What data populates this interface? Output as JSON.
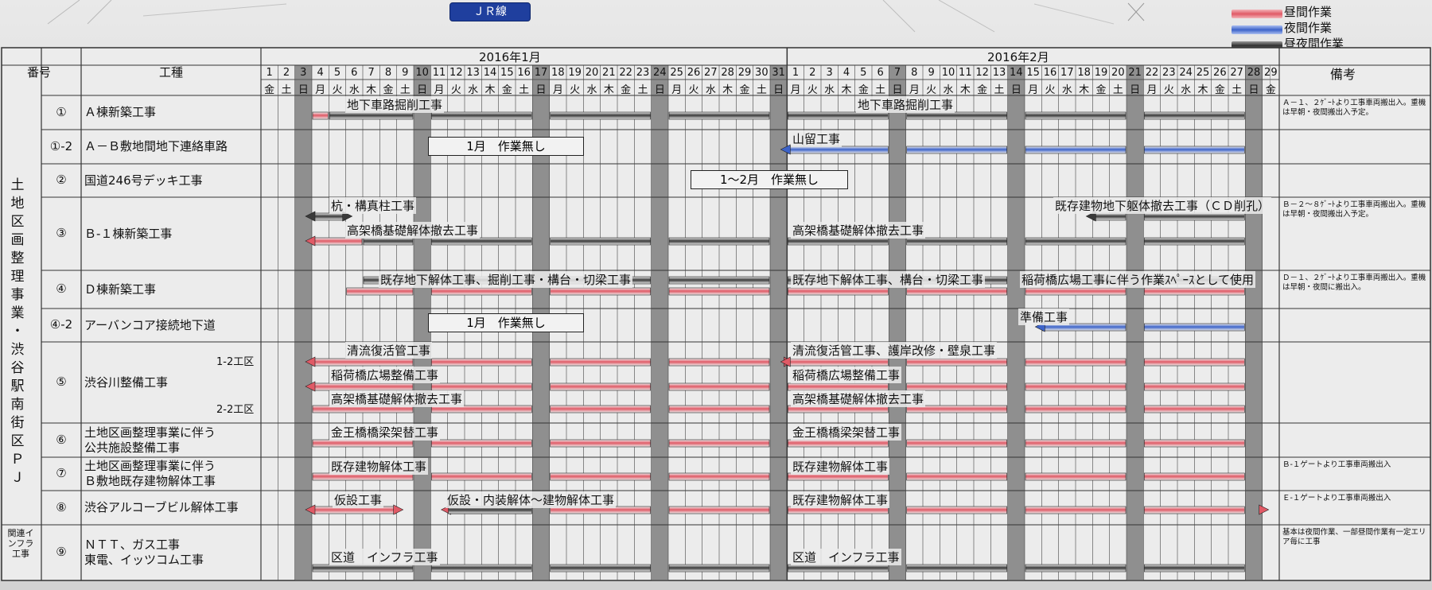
{
  "header": {
    "badge": "ＪＲ線",
    "month1": "2016年1月",
    "month2": "2016年2月",
    "col_no": "番号",
    "col_type": "工種",
    "col_remarks": "備考"
  },
  "legend": [
    {
      "label": "昼間作業",
      "color": "#e05a66"
    },
    {
      "label": "夜間作業",
      "color": "#3d63c9"
    },
    {
      "label": "昼夜間作業",
      "color": "#3a3a3a"
    }
  ],
  "colors": {
    "day": "#e05a66",
    "night": "#3d63c9",
    "both": "#3a3a3a",
    "sunday": "#8f8f8f"
  },
  "jan_days": [
    "1",
    "2",
    "3",
    "4",
    "5",
    "6",
    "7",
    "8",
    "9",
    "10",
    "11",
    "12",
    "13",
    "14",
    "15",
    "16",
    "17",
    "18",
    "19",
    "20",
    "21",
    "22",
    "23",
    "24",
    "25",
    "26",
    "27",
    "28",
    "29",
    "30",
    "31"
  ],
  "jan_weekdays": [
    "金",
    "土",
    "日",
    "月",
    "火",
    "水",
    "木",
    "金",
    "土",
    "日",
    "月",
    "火",
    "水",
    "木",
    "金",
    "土",
    "日",
    "月",
    "火",
    "水",
    "木",
    "金",
    "土",
    "日",
    "月",
    "火",
    "水",
    "木",
    "金",
    "土",
    "日"
  ],
  "feb_days": [
    "1",
    "2",
    "3",
    "4",
    "5",
    "6",
    "7",
    "8",
    "9",
    "10",
    "11",
    "12",
    "13",
    "14",
    "15",
    "16",
    "17",
    "18",
    "19",
    "20",
    "21",
    "22",
    "23",
    "24",
    "25",
    "26",
    "27",
    "28",
    "29"
  ],
  "feb_weekdays": [
    "月",
    "火",
    "水",
    "木",
    "金",
    "土",
    "日",
    "月",
    "火",
    "水",
    "木",
    "金",
    "土",
    "日",
    "月",
    "火",
    "水",
    "木",
    "金",
    "土",
    "日",
    "月",
    "火",
    "水",
    "木",
    "金",
    "土",
    "日",
    "金"
  ],
  "group_labels": {
    "main": [
      "土",
      "地",
      "区",
      "画",
      "整",
      "理",
      "事",
      "業",
      "・",
      "渋",
      "谷",
      "駅",
      "南",
      "街",
      "区",
      "Ｐ",
      "Ｊ"
    ],
    "infra": "関連インフラ工事"
  },
  "rows": [
    {
      "no": "①",
      "type": [
        "Ａ棟新築工事"
      ],
      "remarks": "Ａ－１、２ｹﾞｰﾄより工事車両搬出入。重機は早朝・夜間搬出入予定。"
    },
    {
      "no": "①-2",
      "type": [
        "Ａ－Ｂ敷地間地下連絡車路"
      ],
      "remarks": ""
    },
    {
      "no": "②",
      "type": [
        "国道246号デッキ工事"
      ],
      "remarks": ""
    },
    {
      "no": "③",
      "type": [
        "Ｂ-１棟新築工事"
      ],
      "remarks": "Ｂ－２～８ｹﾞｰﾄより工事車両搬出入。重機は早朝・夜間搬出入予定。"
    },
    {
      "no": "④",
      "type": [
        "Ｄ棟新築工事"
      ],
      "remarks": "Ｄ－１、２ｹﾞｰﾄより工事車両搬出入。重機は早朝・夜間に搬出入。"
    },
    {
      "no": "④-2",
      "type": [
        "アーバンコア接続地下道"
      ],
      "remarks": ""
    },
    {
      "no": "⑤",
      "type": [
        "渋谷川整備工事"
      ],
      "remarks": "",
      "sub1": "1-2工区",
      "sub2": "2-2工区"
    },
    {
      "no": "⑥",
      "type": [
        "土地区画整理事業に伴う",
        "公共施設整備工事"
      ],
      "remarks": ""
    },
    {
      "no": "⑦",
      "type": [
        "土地区画整理事業に伴う",
        "Ｂ敷地既存建物解体工事"
      ],
      "remarks": "Ｂ-１ゲートより工事車両搬出入"
    },
    {
      "no": "⑧",
      "type": [
        "渋谷アルコーブビル解体工事"
      ],
      "remarks": "Ｅ-１ゲートより工事車両搬出入"
    },
    {
      "no": "⑨",
      "type": [
        "ＮＴＴ、ガス工事",
        "東電、イッツコム工事"
      ],
      "remarks": "基本は夜間作業、一部昼間作業有一定エリア毎に工事"
    }
  ],
  "no_work": {
    "r1": "1月　作業無し",
    "r2": "1～2月　作業無し",
    "r5": "1月　作業無し"
  },
  "tasks": [
    {
      "id": "t0a",
      "text": "地下車路掘削工事"
    },
    {
      "id": "t0b",
      "text": "地下車路掘削工事"
    },
    {
      "id": "t1a",
      "text": "山留工事"
    },
    {
      "id": "t3a",
      "text": "杭・構真柱工事"
    },
    {
      "id": "t3b",
      "text": "高架橋基礎解体撤去工事"
    },
    {
      "id": "t3c",
      "text": "高架橋基礎解体撤去工事"
    },
    {
      "id": "t3d",
      "text": "既存建物地下躯体撤去工事（ＣＤ削孔）"
    },
    {
      "id": "t4a",
      "text": "既存地下解体工事、掘削工事・構台・切梁工事"
    },
    {
      "id": "t4b",
      "text": "既存地下解体工事、構台・切梁工事"
    },
    {
      "id": "t4c",
      "text": "稲荷橋広場工事に伴う作業ｽﾍﾟｰｽとして使用"
    },
    {
      "id": "t5a",
      "text": "準備工事"
    },
    {
      "id": "t6a",
      "text": "清流復活管工事"
    },
    {
      "id": "t6b",
      "text": "清流復活管工事、護岸改修・壁泉工事"
    },
    {
      "id": "t6c",
      "text": "稲荷橋広場整備工事"
    },
    {
      "id": "t6d",
      "text": "稲荷橋広場整備工事"
    },
    {
      "id": "t6e",
      "text": "高架橋基礎解体撤去工事"
    },
    {
      "id": "t6f",
      "text": "高架橋基礎解体撤去工事"
    },
    {
      "id": "t7a",
      "text": "金王橋橋梁架替工事"
    },
    {
      "id": "t7b",
      "text": "金王橋橋梁架替工事"
    },
    {
      "id": "t8a",
      "text": "既存建物解体工事"
    },
    {
      "id": "t8b",
      "text": "既存建物解体工事"
    },
    {
      "id": "t9a",
      "text": "仮設工事"
    },
    {
      "id": "t9b",
      "text": "仮設・内装解体～建物解体工事"
    },
    {
      "id": "t9c",
      "text": "既存建物解体工事"
    },
    {
      "id": "t10a",
      "text": "区道　インフラ工事"
    },
    {
      "id": "t10b",
      "text": "区道　インフラ工事"
    }
  ]
}
